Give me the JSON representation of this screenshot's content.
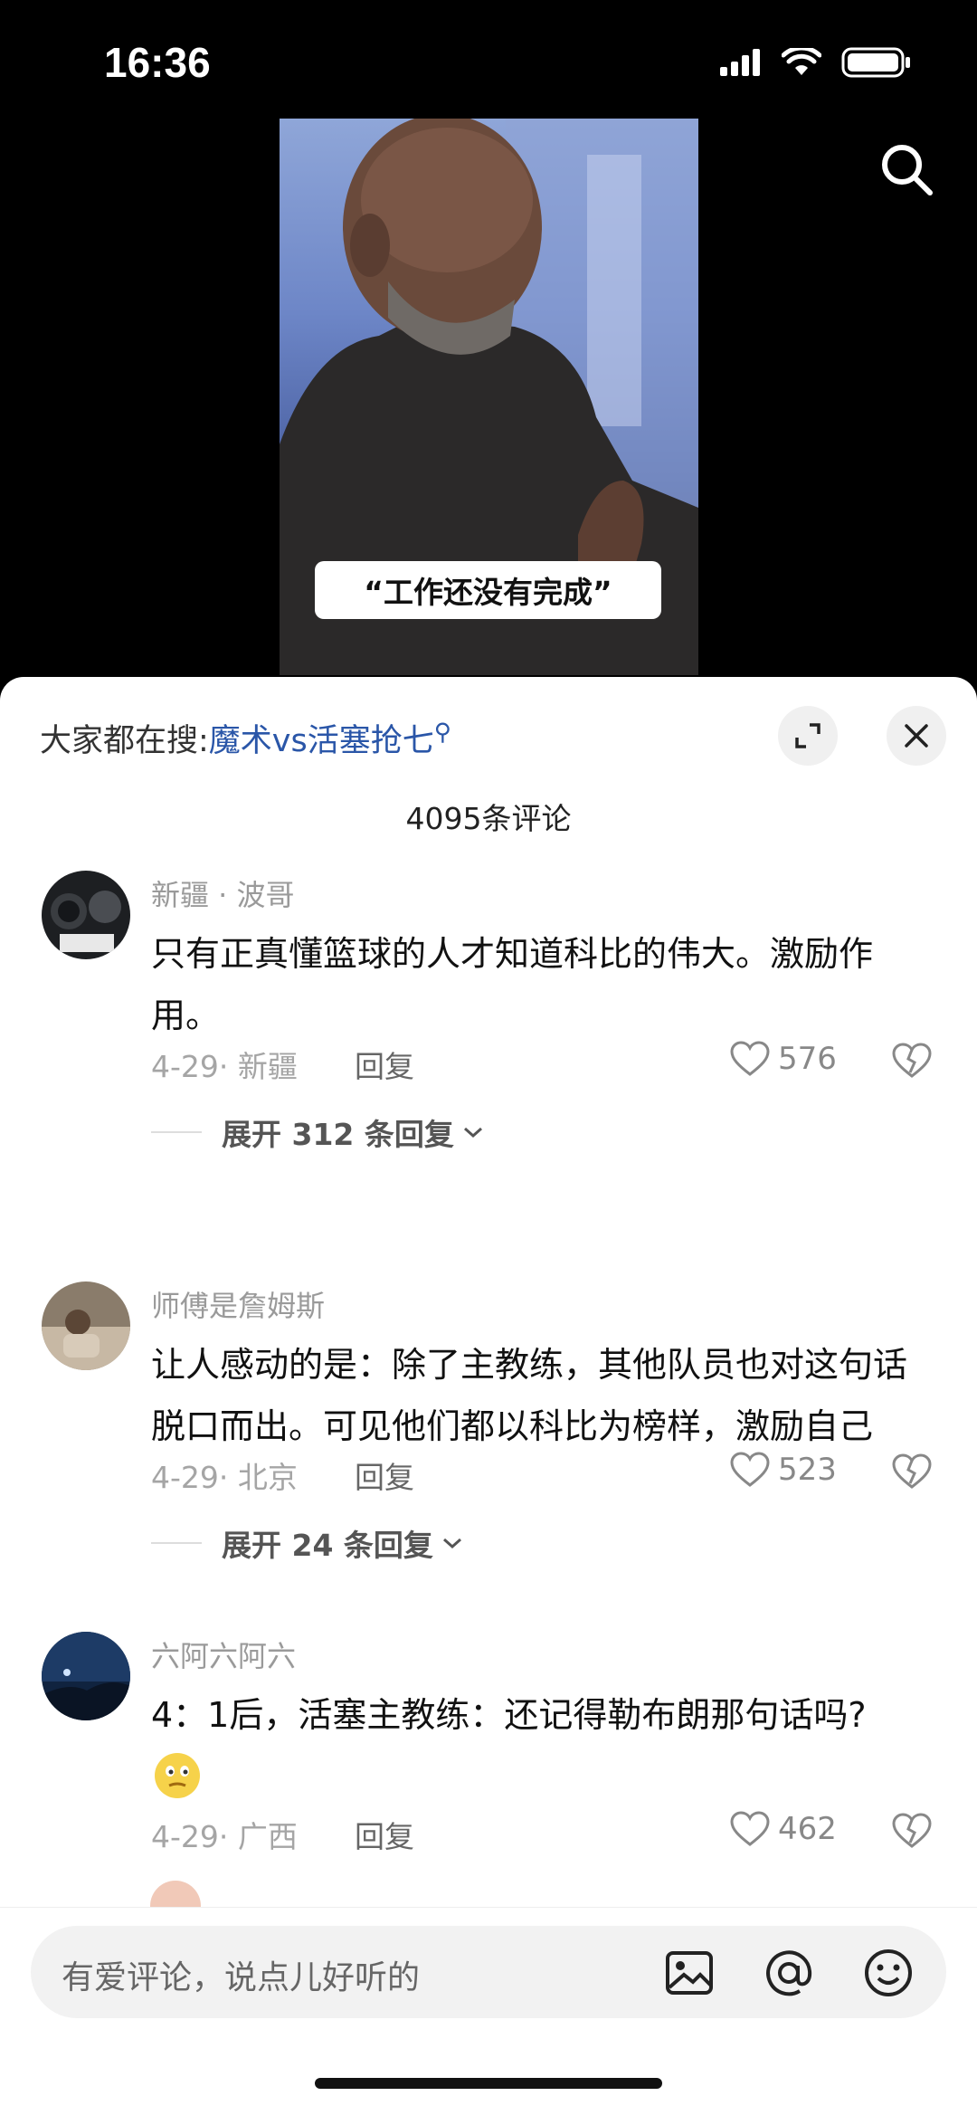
{
  "status_bar": {
    "time": "16:36"
  },
  "video": {
    "caption": "“工作还没有完成”"
  },
  "sheet": {
    "hot_search_prefix": "大家都在搜:",
    "hot_search_query": "魔术vs活塞抢七",
    "comment_count": "4095条评论"
  },
  "comments": [
    {
      "name": "新疆 · 波哥",
      "text": "只有正真懂篮球的人才知道科比的伟大。激励作用。",
      "meta": "4-29· 新疆",
      "reply": "回复",
      "likes": "576",
      "expand": "展开 312 条回复"
    },
    {
      "name": "师傅是詹姆斯",
      "text": "让人感动的是：除了主教练，其他队员也对这句话脱口而出。可见他们都以科比为榜样，激励自己",
      "meta": "4-29· 北京",
      "reply": "回复",
      "likes": "523",
      "expand": "展开 24 条回复"
    },
    {
      "name": "六阿六阿六",
      "text": "4：1后，活塞主教练：还记得勒布朗那句话吗?",
      "meta": "4-29· 广西",
      "reply": "回复",
      "likes": "462"
    }
  ],
  "input_bar": {
    "placeholder": "有爱评论，说点儿好听的"
  },
  "colors": {
    "link": "#2a56a8",
    "meta": "#a5a5a5",
    "sheet_bg": "#ffffff"
  },
  "icons": [
    "search-icon",
    "expand-icon",
    "close-icon",
    "heart-icon",
    "dislike-icon",
    "image-icon",
    "at-icon",
    "emoji-icon"
  ]
}
